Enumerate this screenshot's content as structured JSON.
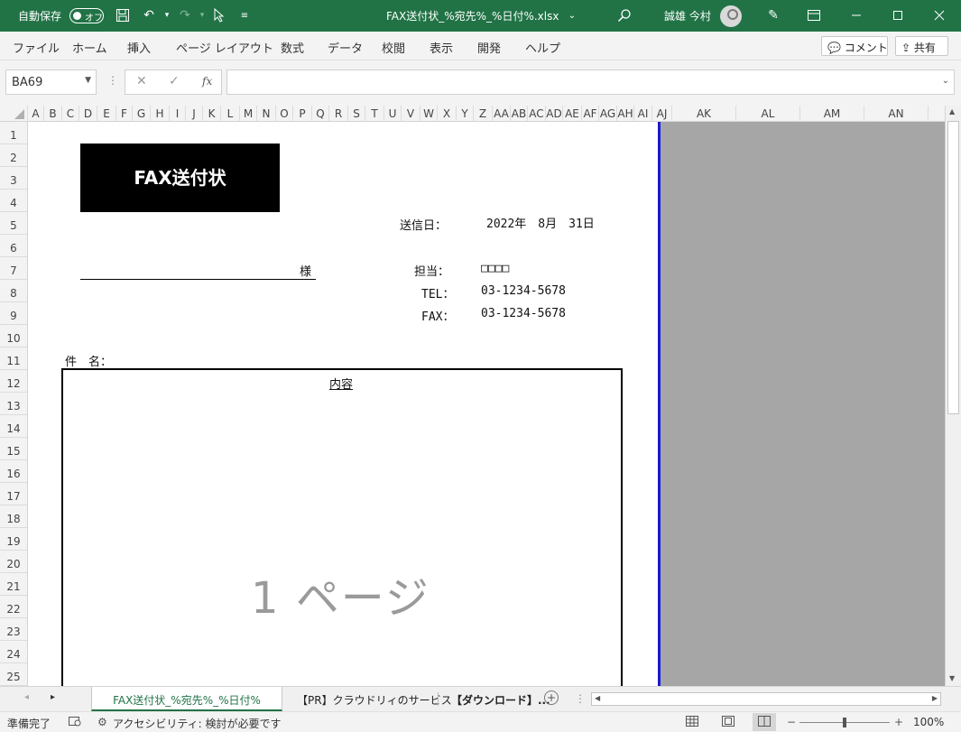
{
  "titlebar": {
    "autosave_label": "自動保存",
    "autosave_state": "オフ",
    "filename": "FAX送付状_%宛先%_%日付%.xlsx",
    "user_name": "誠雄 今村",
    "bg_color": "#217346"
  },
  "ribbon": {
    "tabs": [
      "ファイル",
      "ホーム",
      "挿入",
      "ページ レイアウト",
      "数式",
      "データ",
      "校閲",
      "表示",
      "開発",
      "ヘルプ"
    ],
    "comment_label": "コメント",
    "share_label": "共有"
  },
  "formula_bar": {
    "name_box": "BA69",
    "fx_label": "fx",
    "formula": ""
  },
  "columns": [
    "A",
    "B",
    "C",
    "D",
    "E",
    "F",
    "G",
    "H",
    "I",
    "J",
    "K",
    "L",
    "M",
    "N",
    "O",
    "P",
    "Q",
    "R",
    "S",
    "T",
    "U",
    "V",
    "W",
    "X",
    "Y",
    "Z",
    "AA",
    "AB",
    "AC",
    "AD",
    "AE",
    "AF",
    "AG",
    "AH",
    "AI",
    "AJ",
    "AK",
    "AL",
    "AM",
    "AN"
  ],
  "rows": [
    "1",
    "2",
    "3",
    "4",
    "5",
    "6",
    "7",
    "8",
    "9",
    "10",
    "11",
    "12",
    "13",
    "14",
    "15",
    "16",
    "17",
    "18",
    "19",
    "20",
    "21",
    "22",
    "23",
    "24",
    "25"
  ],
  "sheet": {
    "title": "FAX送付状",
    "send_date_label": "送信日：",
    "send_date_value": "2022年　8月　31日",
    "recipient_suffix": "様",
    "contact_label": "担当：",
    "contact_value": "□□□□",
    "tel_label": "TEL：",
    "tel_value": "03-1234-5678",
    "fax_label": "FAX：",
    "fax_value": "03-1234-5678",
    "subject_label": "件　名：",
    "content_header": "内容",
    "page_watermark": "1 ページ"
  },
  "sheet_tabs": [
    "FAX送付状_%宛先%_%日付%",
    "【PR】クラウドリィのサービス",
    "【ダウンロード】..."
  ],
  "status": {
    "ready": "準備完了",
    "accessibility": "アクセシビリティ: 検討が必要です",
    "zoom": "100%",
    "zoom_level": 0.5
  }
}
